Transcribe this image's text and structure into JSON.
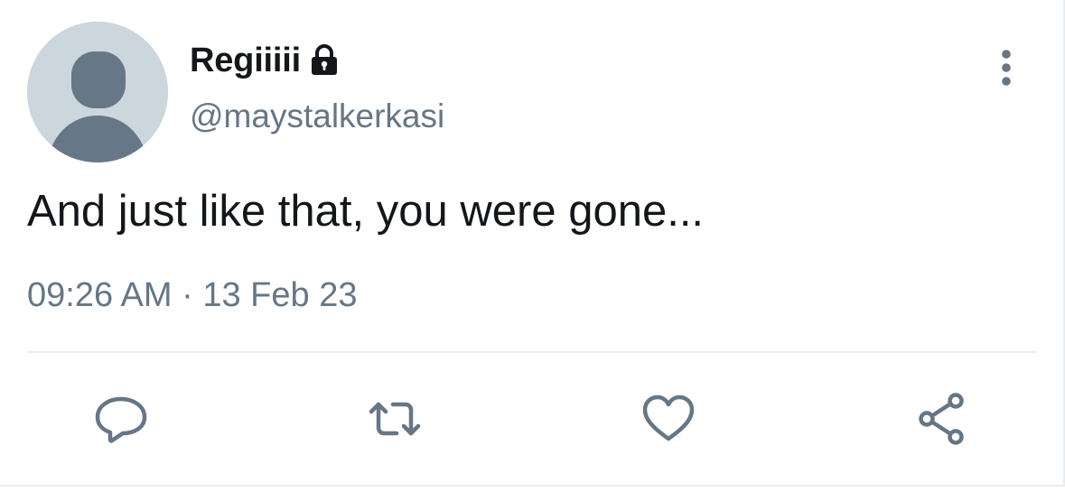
{
  "author": {
    "display_name": "Regiiiii",
    "handle": "@maystalkerkasi",
    "protected_icon": "lock-icon",
    "avatar": "default-avatar"
  },
  "tweet": {
    "text": "And just like that, you were gone...",
    "time": "09:26 AM",
    "separator": "·",
    "date": "13 Feb 23"
  },
  "actions": [
    {
      "name": "reply",
      "icon": "reply-bubble-icon"
    },
    {
      "name": "retweet",
      "icon": "retweet-icon"
    },
    {
      "name": "like",
      "icon": "heart-icon"
    },
    {
      "name": "share",
      "icon": "share-icon"
    }
  ],
  "menu_icon": "more-vertical-icon",
  "colors": {
    "primary_text": "#14171a",
    "secondary_text": "#657786",
    "icon": "#657786",
    "divider": "#e6ecf0",
    "avatar_bg": "#ccd6dd",
    "avatar_fg": "#657786"
  }
}
